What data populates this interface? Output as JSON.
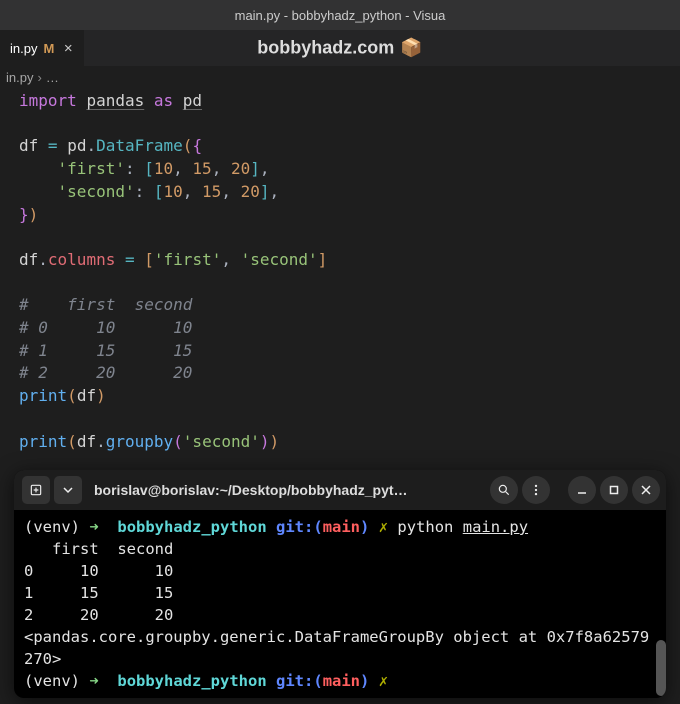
{
  "window": {
    "title": "main.py - bobbyhadz_python - Visua"
  },
  "tab": {
    "filename": "in.py",
    "modified_badge": "M"
  },
  "overlay": {
    "site": "bobbyhadz.com",
    "cube": "📦"
  },
  "breadcrumb": {
    "file": "in.py",
    "sep": "›",
    "more": "…"
  },
  "code": {
    "import_kw": "import",
    "pandas": "pandas",
    "as_kw": "as",
    "pd": "pd",
    "df": "df",
    "eq": "=",
    "DataFrame": "DataFrame",
    "first_key": "'first'",
    "second_key": "'second'",
    "colon": ":",
    "n10": "10",
    "n15": "15",
    "n20": "20",
    "columns": "columns",
    "first_str": "'first'",
    "second_str": "'second'",
    "print": "print",
    "groupby": "groupby",
    "comment1": "#    first  second",
    "comment2": "# 0     10      10",
    "comment3": "# 1     15      15",
    "comment4": "# 2     20      20"
  },
  "terminal": {
    "title": "borislav@borislav:~/Desktop/bobbyhadz_pyt…",
    "venv": "(venv)",
    "arrow": "➜",
    "dir": "bobbyhadz_python",
    "git_label": "git:(",
    "branch": "main",
    "git_close": ")",
    "dirty": "✗",
    "cmd": "python",
    "arg": "main.py",
    "out_header": "   first  second",
    "out_row0": "0     10      10",
    "out_row1": "1     15      15",
    "out_row2": "2     20      20",
    "out_obj": "<pandas.core.groupby.generic.DataFrameGroupBy object at 0x7f8a62579270>"
  }
}
